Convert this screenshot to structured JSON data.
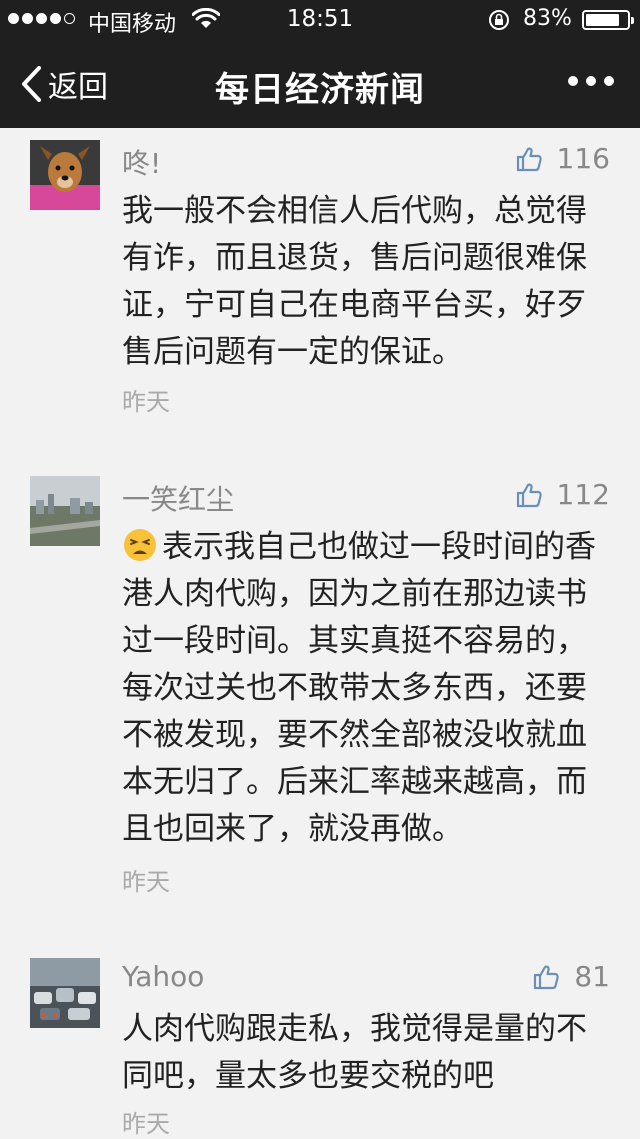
{
  "status_bar": {
    "carrier": "中国移动",
    "time": "18:51",
    "battery": "83%",
    "battery_level": 0.83,
    "signal_bars_filled": 4
  },
  "nav": {
    "back_label": "返回",
    "title": "每日经济新闻"
  },
  "comments": [
    {
      "username": "咚!",
      "likes": "116",
      "text": "我一般不会相信人后代购，总觉得有诈，而且退货，售后问题很难保证，宁可自己在电商平台买，好歹售后问题有一定的保证。",
      "time": "昨天",
      "avatar": "dog-avatar"
    },
    {
      "username": "一笑红尘",
      "likes": "112",
      "emoji": "tired-face-emoji",
      "text": "表示我自己也做过一段时间的香港人肉代购，因为之前在那边读书过一段时间。其实真挺不容易的，每次过关也不敢带太多东西，还要不被发现，要不然全部被没收就血本无归了。后来汇率越来越高，而且也回来了，就没再做。",
      "time": "昨天",
      "avatar": "cityscape-avatar"
    },
    {
      "username": "Yahoo",
      "likes": "81",
      "text": "人肉代购跟走私，我觉得是量的不同吧，量太多也要交税的吧",
      "time": "昨天",
      "avatar": "traffic-avatar"
    }
  ],
  "colors": {
    "bar_bg": "#1f1f1f",
    "page_bg": "#f2f2f2",
    "like_blue": "#6b8fb6",
    "meta_gray": "#888888"
  }
}
